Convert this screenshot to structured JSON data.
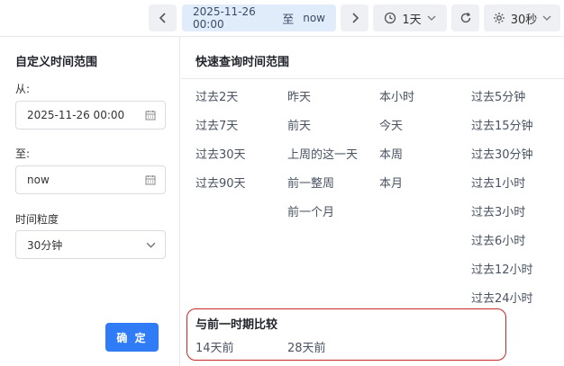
{
  "toolbar": {
    "range_start": "2025-11-26 00:00",
    "range_sep": "至",
    "range_end": "now",
    "interval_label": "1天",
    "refresh_label": "30秒"
  },
  "custom": {
    "title": "自定义时间范围",
    "from_label": "从:",
    "from_value": "2025-11-26 00:00",
    "to_label": "至:",
    "to_value": "now",
    "granularity_label": "时间粒度",
    "granularity_value": "30分钟",
    "confirm_label": "确 定"
  },
  "quick": {
    "title": "快速查询时间范围",
    "col1": [
      "过去2天",
      "过去7天",
      "过去30天",
      "过去90天"
    ],
    "col2": [
      "昨天",
      "前天",
      "上周的这一天",
      "前一整周",
      "前一个月"
    ],
    "col3": [
      "本小时",
      "今天",
      "本周",
      "本月"
    ],
    "col4": [
      "过去5分钟",
      "过去15分钟",
      "过去30分钟",
      "过去1小时",
      "过去3小时",
      "过去6小时",
      "过去12小时",
      "过去24小时"
    ]
  },
  "compare": {
    "title": "与前一时期比较",
    "items": [
      "14天前",
      "28天前"
    ]
  },
  "colors": {
    "accent": "#2f7cf6",
    "highlight_border": "#c62828",
    "range_bg": "#e1ecfb"
  }
}
